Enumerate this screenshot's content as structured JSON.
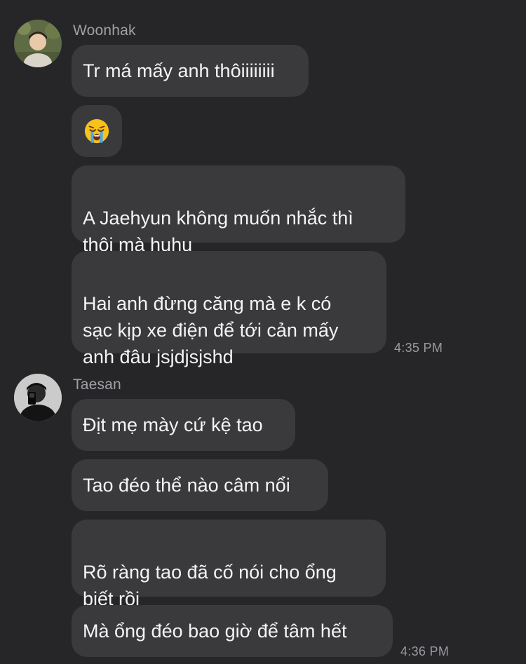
{
  "groups": [
    {
      "sender": "Woonhak",
      "avatar_icon": "user-photo-avatar",
      "messages": [
        {
          "text": "Tr má mấy anh thôiiiiiiii"
        },
        {
          "emoji": "loudly-crying-face-icon"
        },
        {
          "text": "A Jaehyun không muốn nhắc thì\nthôi mà huhu"
        },
        {
          "text": "Hai anh đừng căng mà e k có\nsạc kịp xe điện để tới cản mấy\nanh đâu jsjdjsjshd"
        }
      ],
      "timestamp": "4:35 PM"
    },
    {
      "sender": "Taesan",
      "avatar_icon": "user-photo-avatar",
      "messages": [
        {
          "text": "Địt mẹ mày cứ kệ tao"
        },
        {
          "text": "Tao đéo thể nào câm nổi"
        },
        {
          "text": "Rõ ràng tao đã cố nói cho ổng\nbiết rồi"
        },
        {
          "text": "Mà ổng đéo bao giờ để tâm hết"
        }
      ],
      "timestamp": "4:36 PM"
    }
  ],
  "colors": {
    "background": "#262629",
    "bubble": "#3a3a3d",
    "text": "#f4f4f4",
    "secondary_text": "#a0a0a6"
  }
}
